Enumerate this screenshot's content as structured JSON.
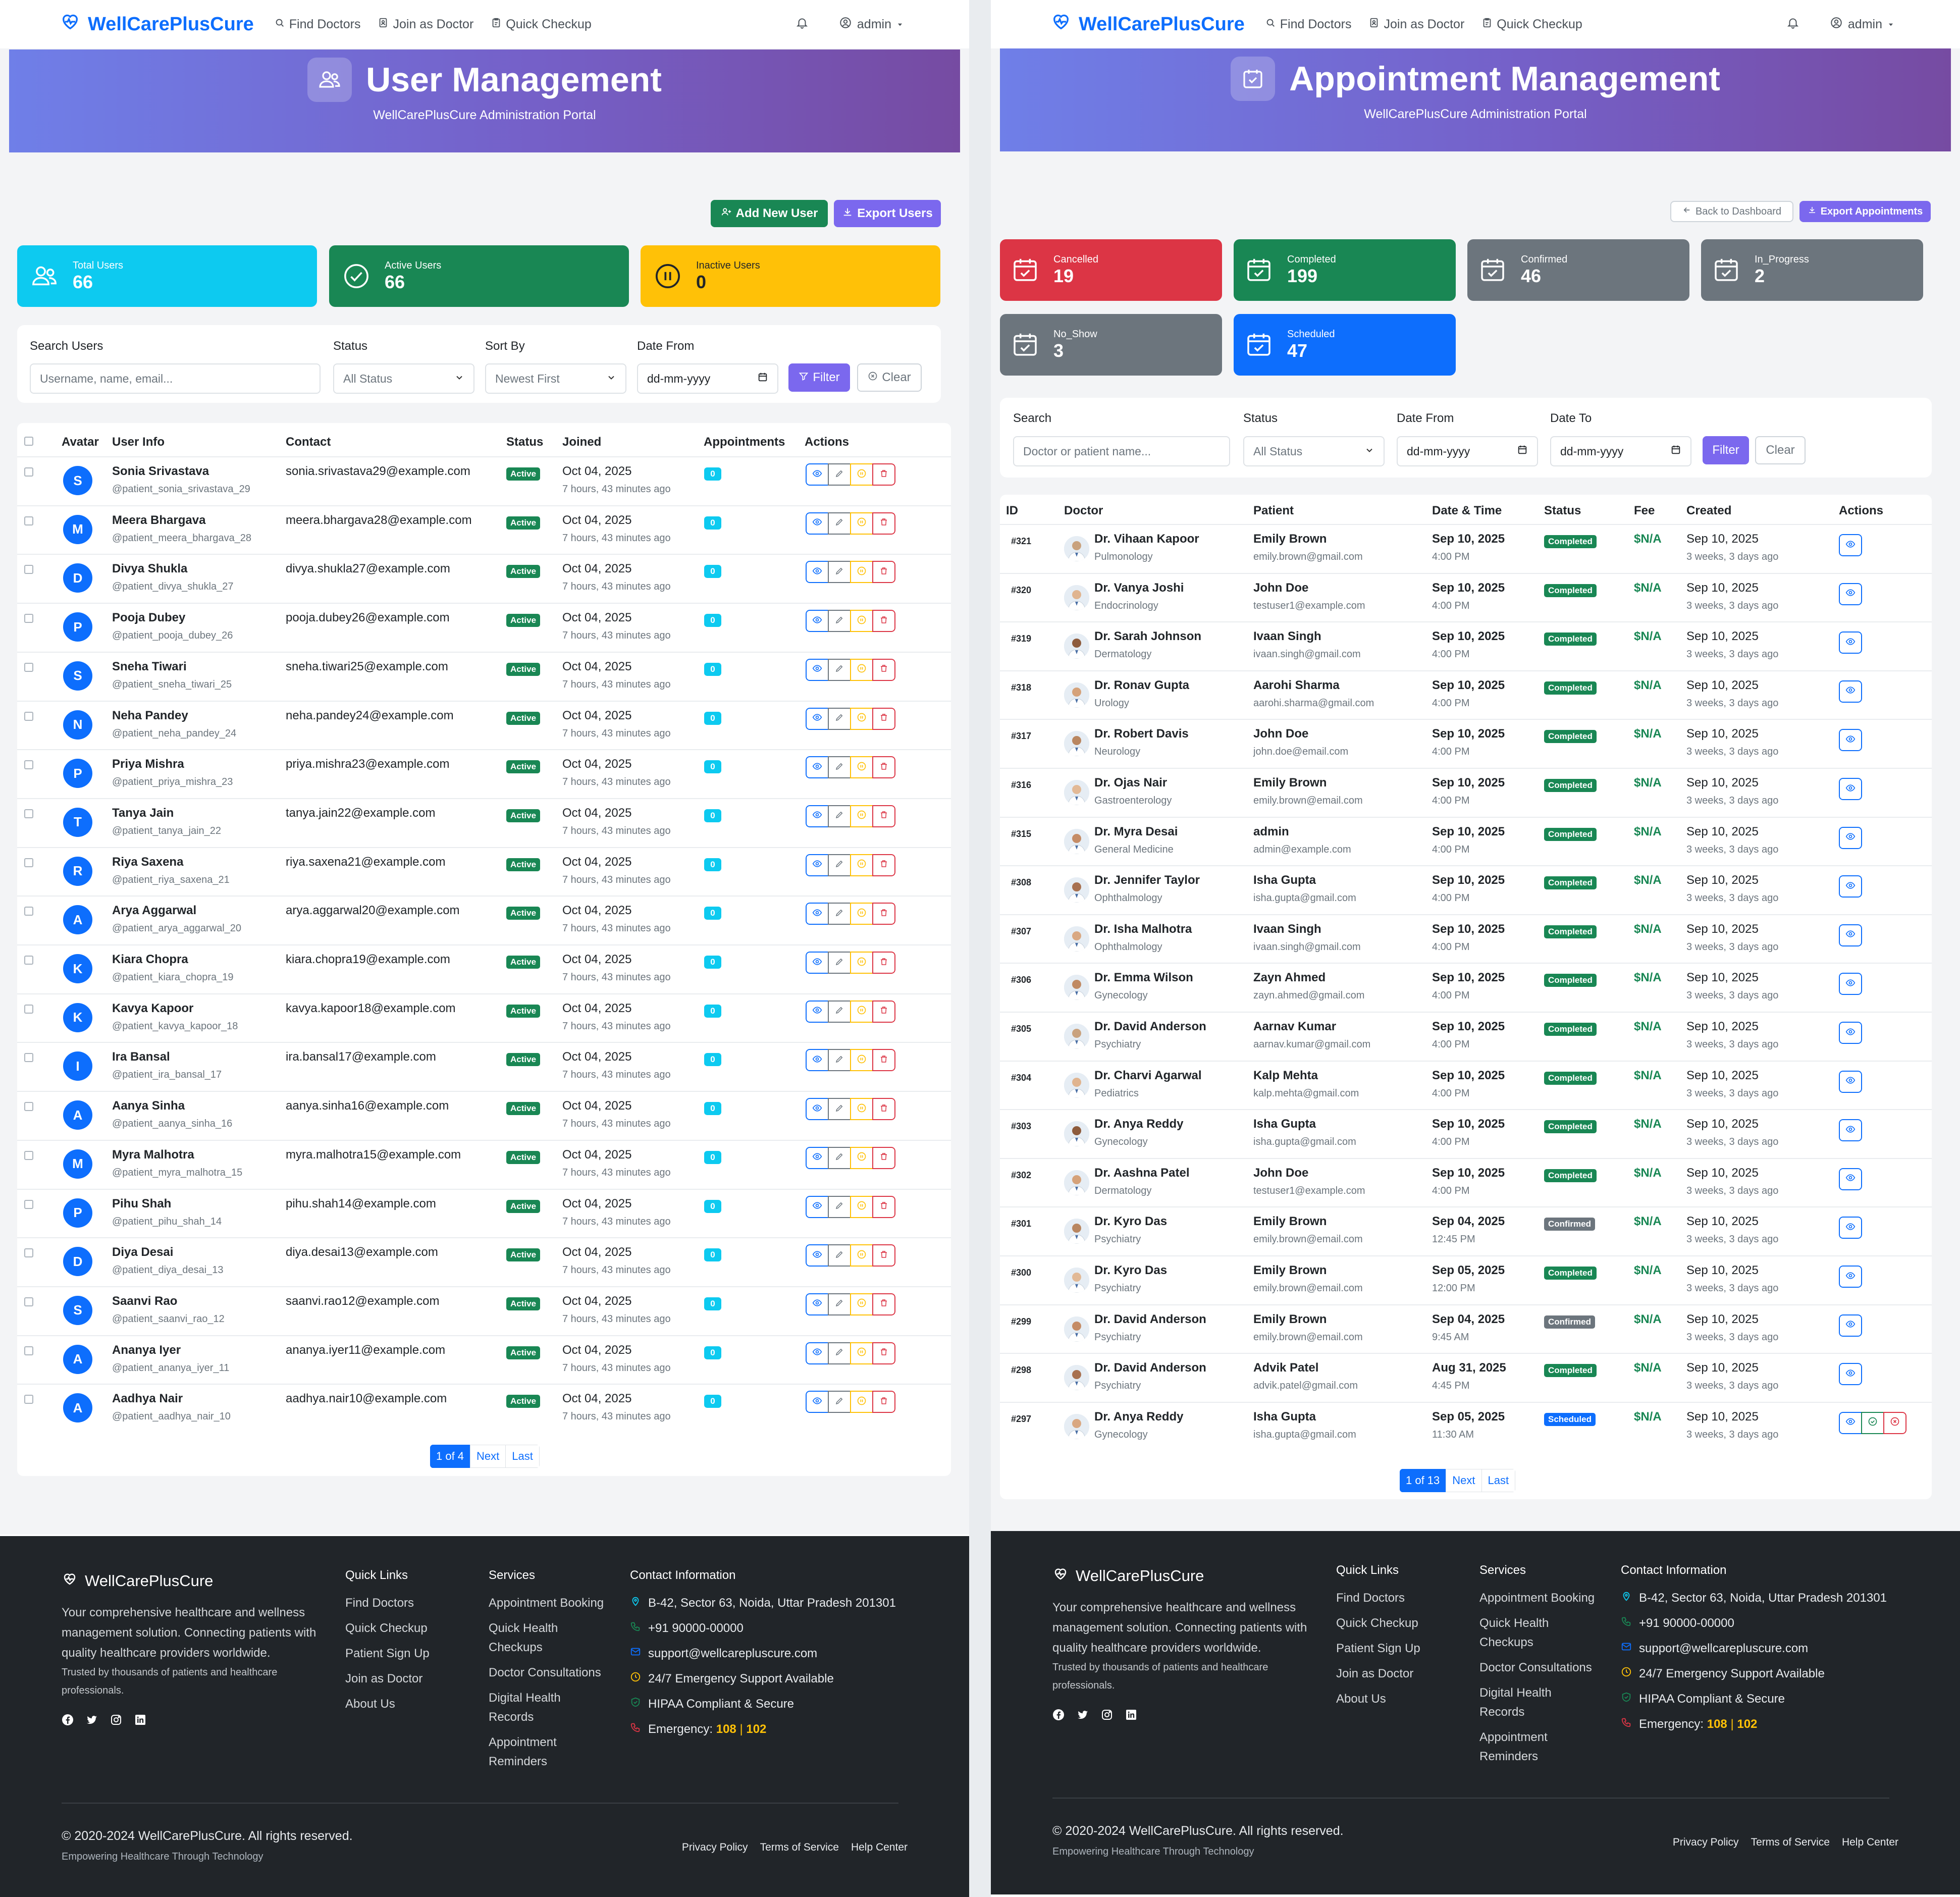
{
  "navbar": {
    "brand": "WellCarePlusCure",
    "find_doctors": "Find Doctors",
    "join_doctor": "Join as Doctor",
    "quick_checkup": "Quick Checkup",
    "user": "admin"
  },
  "users_page": {
    "title": "User Management",
    "subtitle": "WellCarePlusCure Administration Portal",
    "add_user": "Add New User",
    "export": "Export Users",
    "stats": [
      {
        "label": "Total Users",
        "value": "66",
        "color": "#0dcaf0"
      },
      {
        "label": "Active Users",
        "value": "66",
        "color": "#198754"
      },
      {
        "label": "Inactive Users",
        "value": "0",
        "color": "#ffc107"
      }
    ],
    "filters": {
      "search_label": "Search Users",
      "search_placeholder": "Username, name, email...",
      "status_label": "Status",
      "status_value": "All Status",
      "sort_label": "Sort By",
      "sort_value": "Newest First",
      "date_label": "Date From",
      "date_placeholder": "dd-mm-yyyy",
      "filter_btn": "Filter",
      "clear_btn": "Clear"
    },
    "columns": [
      "Avatar",
      "User Info",
      "Contact",
      "Status",
      "Joined",
      "Appointments",
      "Actions"
    ],
    "joined_date": "Oct 04, 2025",
    "joined_ago": "7 hours, 43 minutes ago",
    "status_text": "Active",
    "appointments_count": "0",
    "rows": [
      {
        "initial": "S",
        "name": "Sonia Srivastava",
        "handle": "@patient_sonia_srivastava_29",
        "email": "sonia.srivastava29@example.com"
      },
      {
        "initial": "M",
        "name": "Meera Bhargava",
        "handle": "@patient_meera_bhargava_28",
        "email": "meera.bhargava28@example.com"
      },
      {
        "initial": "D",
        "name": "Divya Shukla",
        "handle": "@patient_divya_shukla_27",
        "email": "divya.shukla27@example.com"
      },
      {
        "initial": "P",
        "name": "Pooja Dubey",
        "handle": "@patient_pooja_dubey_26",
        "email": "pooja.dubey26@example.com"
      },
      {
        "initial": "S",
        "name": "Sneha Tiwari",
        "handle": "@patient_sneha_tiwari_25",
        "email": "sneha.tiwari25@example.com"
      },
      {
        "initial": "N",
        "name": "Neha Pandey",
        "handle": "@patient_neha_pandey_24",
        "email": "neha.pandey24@example.com"
      },
      {
        "initial": "P",
        "name": "Priya Mishra",
        "handle": "@patient_priya_mishra_23",
        "email": "priya.mishra23@example.com"
      },
      {
        "initial": "T",
        "name": "Tanya Jain",
        "handle": "@patient_tanya_jain_22",
        "email": "tanya.jain22@example.com"
      },
      {
        "initial": "R",
        "name": "Riya Saxena",
        "handle": "@patient_riya_saxena_21",
        "email": "riya.saxena21@example.com"
      },
      {
        "initial": "A",
        "name": "Arya Aggarwal",
        "handle": "@patient_arya_aggarwal_20",
        "email": "arya.aggarwal20@example.com"
      },
      {
        "initial": "K",
        "name": "Kiara Chopra",
        "handle": "@patient_kiara_chopra_19",
        "email": "kiara.chopra19@example.com"
      },
      {
        "initial": "K",
        "name": "Kavya Kapoor",
        "handle": "@patient_kavya_kapoor_18",
        "email": "kavya.kapoor18@example.com"
      },
      {
        "initial": "I",
        "name": "Ira Bansal",
        "handle": "@patient_ira_bansal_17",
        "email": "ira.bansal17@example.com"
      },
      {
        "initial": "A",
        "name": "Aanya Sinha",
        "handle": "@patient_aanya_sinha_16",
        "email": "aanya.sinha16@example.com"
      },
      {
        "initial": "M",
        "name": "Myra Malhotra",
        "handle": "@patient_myra_malhotra_15",
        "email": "myra.malhotra15@example.com"
      },
      {
        "initial": "P",
        "name": "Pihu Shah",
        "handle": "@patient_pihu_shah_14",
        "email": "pihu.shah14@example.com"
      },
      {
        "initial": "D",
        "name": "Diya Desai",
        "handle": "@patient_diya_desai_13",
        "email": "diya.desai13@example.com"
      },
      {
        "initial": "S",
        "name": "Saanvi Rao",
        "handle": "@patient_saanvi_rao_12",
        "email": "saanvi.rao12@example.com"
      },
      {
        "initial": "A",
        "name": "Ananya Iyer",
        "handle": "@patient_ananya_iyer_11",
        "email": "ananya.iyer11@example.com"
      },
      {
        "initial": "A",
        "name": "Aadhya Nair",
        "handle": "@patient_aadhya_nair_10",
        "email": "aadhya.nair10@example.com"
      }
    ],
    "pager": {
      "current": "1 of 4",
      "next": "Next",
      "last": "Last"
    }
  },
  "appointments_page": {
    "title": "Appointment Management",
    "subtitle": "WellCarePlusCure Administration Portal",
    "back": "Back to Dashboard",
    "export": "Export Appointments",
    "stats": [
      {
        "label": "Cancelled",
        "value": "19",
        "color": "#dc3545"
      },
      {
        "label": "Completed",
        "value": "199",
        "color": "#198754"
      },
      {
        "label": "Confirmed",
        "value": "46",
        "color": "#6c757d"
      },
      {
        "label": "In_Progress",
        "value": "2",
        "color": "#6c757d"
      },
      {
        "label": "No_Show",
        "value": "3",
        "color": "#6c757d"
      },
      {
        "label": "Scheduled",
        "value": "47",
        "color": "#0d6efd"
      }
    ],
    "filters": {
      "search_label": "Search",
      "search_placeholder": "Doctor or patient name...",
      "status_label": "Status",
      "status_value": "All Status",
      "from_label": "Date From",
      "to_label": "Date To",
      "date_placeholder": "dd-mm-yyyy",
      "filter_btn": "Filter",
      "clear_btn": "Clear"
    },
    "columns": [
      "ID",
      "Doctor",
      "Patient",
      "Date & Time",
      "Status",
      "Fee",
      "Created",
      "Actions"
    ],
    "fee": "$N/A",
    "created_date": "Sep 10, 2025",
    "created_ago": "3 weeks, 3 days ago",
    "rows": [
      {
        "id": "#321",
        "doctor": "Dr. Vihaan Kapoor",
        "spec": "Pulmonology",
        "patient": "Emily Brown",
        "pemail": "emily.brown@gmail.com",
        "date": "Sep 10, 2025",
        "time": "4:00 PM",
        "status": "Completed",
        "scolor": "#198754"
      },
      {
        "id": "#320",
        "doctor": "Dr. Vanya Joshi",
        "spec": "Endocrinology",
        "patient": "John Doe",
        "pemail": "testuser1@example.com",
        "date": "Sep 10, 2025",
        "time": "4:00 PM",
        "status": "Completed",
        "scolor": "#198754"
      },
      {
        "id": "#319",
        "doctor": "Dr. Sarah Johnson",
        "spec": "Dermatology",
        "patient": "Ivaan Singh",
        "pemail": "ivaan.singh@gmail.com",
        "date": "Sep 10, 2025",
        "time": "4:00 PM",
        "status": "Completed",
        "scolor": "#198754"
      },
      {
        "id": "#318",
        "doctor": "Dr. Ronav Gupta",
        "spec": "Urology",
        "patient": "Aarohi Sharma",
        "pemail": "aarohi.sharma@gmail.com",
        "date": "Sep 10, 2025",
        "time": "4:00 PM",
        "status": "Completed",
        "scolor": "#198754"
      },
      {
        "id": "#317",
        "doctor": "Dr. Robert Davis",
        "spec": "Neurology",
        "patient": "John Doe",
        "pemail": "john.doe@email.com",
        "date": "Sep 10, 2025",
        "time": "4:00 PM",
        "status": "Completed",
        "scolor": "#198754"
      },
      {
        "id": "#316",
        "doctor": "Dr. Ojas Nair",
        "spec": "Gastroenterology",
        "patient": "Emily Brown",
        "pemail": "emily.brown@email.com",
        "date": "Sep 10, 2025",
        "time": "4:00 PM",
        "status": "Completed",
        "scolor": "#198754"
      },
      {
        "id": "#315",
        "doctor": "Dr. Myra Desai",
        "spec": "General Medicine",
        "patient": "admin",
        "pemail": "admin@example.com",
        "date": "Sep 10, 2025",
        "time": "4:00 PM",
        "status": "Completed",
        "scolor": "#198754"
      },
      {
        "id": "#308",
        "doctor": "Dr. Jennifer Taylor",
        "spec": "Ophthalmology",
        "patient": "Isha Gupta",
        "pemail": "isha.gupta@gmail.com",
        "date": "Sep 10, 2025",
        "time": "4:00 PM",
        "status": "Completed",
        "scolor": "#198754"
      },
      {
        "id": "#307",
        "doctor": "Dr. Isha Malhotra",
        "spec": "Ophthalmology",
        "patient": "Ivaan Singh",
        "pemail": "ivaan.singh@gmail.com",
        "date": "Sep 10, 2025",
        "time": "4:00 PM",
        "status": "Completed",
        "scolor": "#198754"
      },
      {
        "id": "#306",
        "doctor": "Dr. Emma Wilson",
        "spec": "Gynecology",
        "patient": "Zayn Ahmed",
        "pemail": "zayn.ahmed@gmail.com",
        "date": "Sep 10, 2025",
        "time": "4:00 PM",
        "status": "Completed",
        "scolor": "#198754"
      },
      {
        "id": "#305",
        "doctor": "Dr. David Anderson",
        "spec": "Psychiatry",
        "patient": "Aarnav Kumar",
        "pemail": "aarnav.kumar@gmail.com",
        "date": "Sep 10, 2025",
        "time": "4:00 PM",
        "status": "Completed",
        "scolor": "#198754"
      },
      {
        "id": "#304",
        "doctor": "Dr. Charvi Agarwal",
        "spec": "Pediatrics",
        "patient": "Kalp Mehta",
        "pemail": "kalp.mehta@gmail.com",
        "date": "Sep 10, 2025",
        "time": "4:00 PM",
        "status": "Completed",
        "scolor": "#198754"
      },
      {
        "id": "#303",
        "doctor": "Dr. Anya Reddy",
        "spec": "Gynecology",
        "patient": "Isha Gupta",
        "pemail": "isha.gupta@gmail.com",
        "date": "Sep 10, 2025",
        "time": "4:00 PM",
        "status": "Completed",
        "scolor": "#198754"
      },
      {
        "id": "#302",
        "doctor": "Dr. Aashna Patel",
        "spec": "Dermatology",
        "patient": "John Doe",
        "pemail": "testuser1@example.com",
        "date": "Sep 10, 2025",
        "time": "4:00 PM",
        "status": "Completed",
        "scolor": "#198754"
      },
      {
        "id": "#301",
        "doctor": "Dr. Kyro Das",
        "spec": "Psychiatry",
        "patient": "Emily Brown",
        "pemail": "emily.brown@email.com",
        "date": "Sep 04, 2025",
        "time": "12:45 PM",
        "status": "Confirmed",
        "scolor": "#6c757d"
      },
      {
        "id": "#300",
        "doctor": "Dr. Kyro Das",
        "spec": "Psychiatry",
        "patient": "Emily Brown",
        "pemail": "emily.brown@email.com",
        "date": "Sep 05, 2025",
        "time": "12:00 PM",
        "status": "Completed",
        "scolor": "#198754"
      },
      {
        "id": "#299",
        "doctor": "Dr. David Anderson",
        "spec": "Psychiatry",
        "patient": "Emily Brown",
        "pemail": "emily.brown@email.com",
        "date": "Sep 04, 2025",
        "time": "9:45 AM",
        "status": "Confirmed",
        "scolor": "#6c757d"
      },
      {
        "id": "#298",
        "doctor": "Dr. David Anderson",
        "spec": "Psychiatry",
        "patient": "Advik Patel",
        "pemail": "advik.patel@gmail.com",
        "date": "Aug 31, 2025",
        "time": "4:45 PM",
        "status": "Completed",
        "scolor": "#198754"
      },
      {
        "id": "#297",
        "doctor": "Dr. Anya Reddy",
        "spec": "Gynecology",
        "patient": "Isha Gupta",
        "pemail": "isha.gupta@gmail.com",
        "date": "Sep 05, 2025",
        "time": "11:30 AM",
        "status": "Scheduled",
        "scolor": "#0d6efd"
      }
    ],
    "pager": {
      "current": "1 of 13",
      "next": "Next",
      "last": "Last"
    }
  },
  "footer": {
    "brand": "WellCarePlusCure",
    "about": "Your comprehensive healthcare and wellness management solution. Connecting patients with quality healthcare providers worldwide.",
    "trust": "Trusted by thousands of patients and healthcare professionals.",
    "quick_links_title": "Quick Links",
    "quick_links": [
      "Find Doctors",
      "Quick Checkup",
      "Patient Sign Up",
      "Join as Doctor",
      "About Us"
    ],
    "services_title": "Services",
    "services": [
      "Appointment Booking",
      "Quick Health Checkups",
      "Doctor Consultations",
      "Digital Health Records",
      "Appointment Reminders"
    ],
    "contact_title": "Contact Information",
    "address": "B-42, Sector 63, Noida, Uttar Pradesh 201301",
    "phone": "+91 90000-00000",
    "email": "support@wellcarepluscure.com",
    "support": "24/7 Emergency Support Available",
    "hipaa": "HIPAA Compliant & Secure",
    "emergency_label": "Emergency:",
    "emergency_1": "108",
    "emergency_sep": "|",
    "emergency_2": "102",
    "copyright": "© 2020-2024 WellCarePlusCure. All rights reserved.",
    "tagline": "Empowering Healthcare Through Technology",
    "privacy": "Privacy Policy",
    "terms": "Terms of Service",
    "help": "Help Center"
  }
}
